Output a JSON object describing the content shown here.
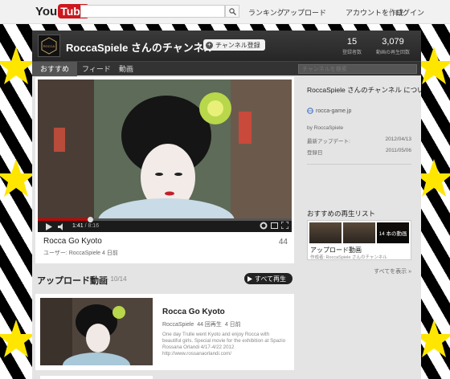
{
  "topbar": {
    "logo_you": "You",
    "logo_tube": "Tube",
    "search_placeholder": "",
    "links": [
      "ランキング",
      "アップロード"
    ],
    "account_links": [
      "アカウントを作成",
      "ログイン"
    ]
  },
  "channel": {
    "title": "RoccaSpiele さんのチャンネル",
    "subscribe_label": "チャンネル登録",
    "stats": [
      {
        "value": "15",
        "label": "登録者数"
      },
      {
        "value": "3,079",
        "label": "動画の再生回数"
      }
    ],
    "tabs": [
      "おすすめ",
      "フィード",
      "動画"
    ],
    "active_tab": "おすすめ",
    "search_placeholder": "チャンネルを検索"
  },
  "featured_video": {
    "title": "Rocca Go Kyoto",
    "views": "44",
    "meta": "ユーザー: RoccaSpiele 4 日前",
    "time_current": "1:41",
    "time_total": "8:16",
    "progress_fraction": 0.205
  },
  "uploads": {
    "title": "アップロード動画",
    "range": "1 - 10/14",
    "play_all_label": "すべて再生",
    "items": [
      {
        "title": "Rocca Go Kyoto",
        "channel": "RoccaSpiele",
        "views": "44 回再生",
        "age": "4 日前",
        "description": "One day Trulle went Kyoto and enjoy Rocca with beautiful girls. Special movie for the exhibition at Spazio Rossana Orlandi 4/17-4/22 2012 http://www.rossanaorlandi.com/"
      }
    ]
  },
  "about": {
    "heading": "RoccaSpiele さんのチャンネル について",
    "link": "rocca-game.jp",
    "by": "by RoccaSpiele",
    "rows": [
      {
        "label": "最新アップデート:",
        "value": "2012/04/13"
      },
      {
        "label": "登録日",
        "value": "2011/05/06"
      }
    ]
  },
  "playlists": {
    "heading": "おすすめの再生リスト",
    "items": [
      {
        "title": "アップロード動画",
        "count": "14 本の動画",
        "subtitle": "作成者: RoccaSpiele さんのチャンネル"
      }
    ],
    "see_all": "すべてを表示 »"
  },
  "colors": {
    "accent_red": "#cc181e",
    "star_yellow": "#ffe600"
  }
}
